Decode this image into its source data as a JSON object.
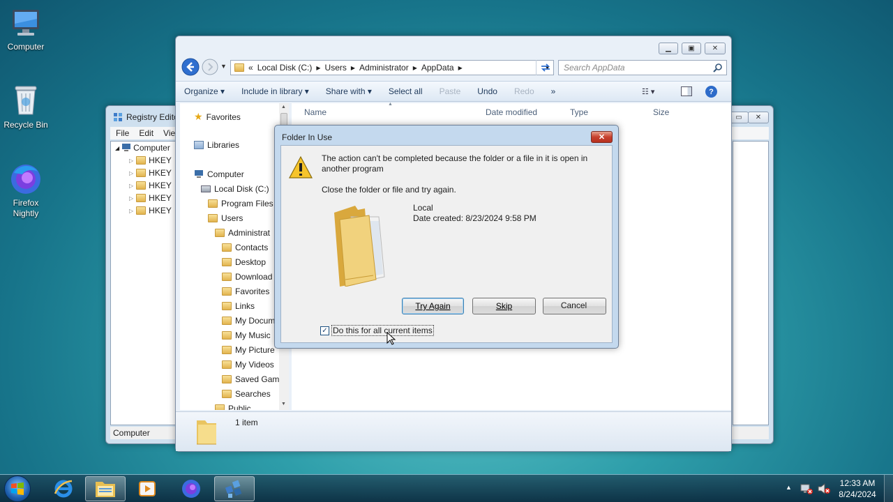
{
  "desktop": {
    "icons": [
      {
        "label": "Computer"
      },
      {
        "label": "Recycle Bin"
      },
      {
        "label": "Firefox Nightly"
      }
    ]
  },
  "registry": {
    "title": "Registry Edito",
    "menu": [
      "File",
      "Edit",
      "View"
    ],
    "tree_root": "Computer",
    "keys": [
      "HKEY",
      "HKEY",
      "HKEY",
      "HKEY",
      "HKEY"
    ],
    "status": "Computer"
  },
  "explorer": {
    "breadcrumb": [
      "«",
      "Local Disk (C:)",
      "Users",
      "Administrator",
      "AppData"
    ],
    "search_placeholder": "Search AppData",
    "toolbar": {
      "organize": "Organize",
      "include": "Include in library",
      "share": "Share with",
      "select_all": "Select all",
      "paste": "Paste",
      "undo": "Undo",
      "redo": "Redo",
      "more": "»"
    },
    "nav": {
      "favorites": "Favorites",
      "libraries": "Libraries",
      "computer": "Computer",
      "local_disk": "Local Disk (C:)",
      "program_files": "Program Files",
      "users": "Users",
      "administrator": "Administrat",
      "contacts": "Contacts",
      "desktop": "Desktop",
      "downloads": "Download",
      "favorites2": "Favorites",
      "links": "Links",
      "documents": "My Docum",
      "music": "My Music",
      "pictures": "My Picture",
      "videos": "My Videos",
      "saved_games": "Saved Gam",
      "searches": "Searches",
      "public": "Public"
    },
    "columns": {
      "name": "Name",
      "date": "Date modified",
      "type": "Type",
      "size": "Size"
    },
    "status_text": "1 item"
  },
  "dialog": {
    "title": "Folder In Use",
    "message": "The action can't be completed because the folder or a file in it is open in another program",
    "instruction": "Close the folder or file and try again.",
    "item_name": "Local",
    "item_date": "Date created: 8/23/2024 9:58 PM",
    "try_again": "Try Again",
    "skip": "Skip",
    "cancel": "Cancel",
    "checkbox_label": "Do this for all current items",
    "checkbox_checked": true
  },
  "taskbar": {
    "time": "12:33 AM",
    "date": "8/24/2024"
  }
}
